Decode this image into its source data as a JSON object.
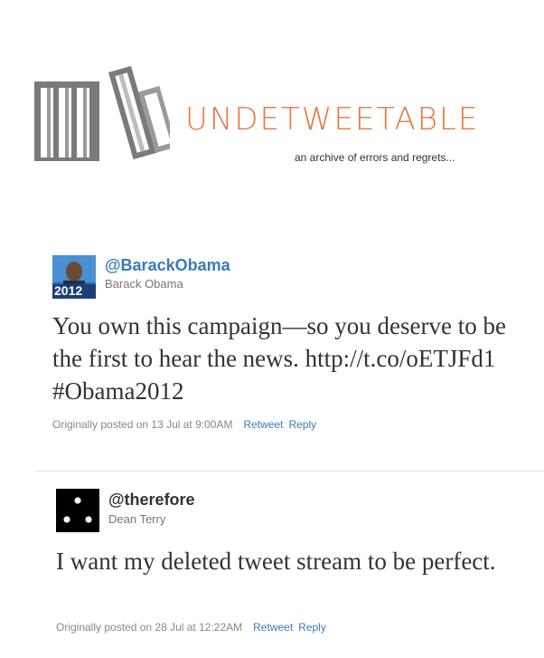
{
  "site": {
    "title": "UNDETWEETABLE",
    "tagline": "an archive of errors and regrets..."
  },
  "colors": {
    "title": "#e8763f",
    "link": "#3b7bb8",
    "handle_obama": "#3b7bb8",
    "handle_therefore": "#333333"
  },
  "tweets": [
    {
      "handle": "@BarackObama",
      "name": "Barack Obama",
      "avatar_badge": "2012",
      "text": "You own this campaign—so you deserve to be the first to hear the news. http://t.co/oETJFd1 #Obama2012",
      "posted": "Originally posted on 13 Jul at 9:00AM",
      "retweet_label": "Retweet",
      "reply_label": "Reply"
    },
    {
      "handle": "@therefore",
      "name": "Dean Terry",
      "text": "I want my deleted tweet stream to be perfect.",
      "posted": "Originally posted on 28 Jul at 12:22AM",
      "retweet_label": "Retweet",
      "reply_label": "Reply"
    }
  ]
}
